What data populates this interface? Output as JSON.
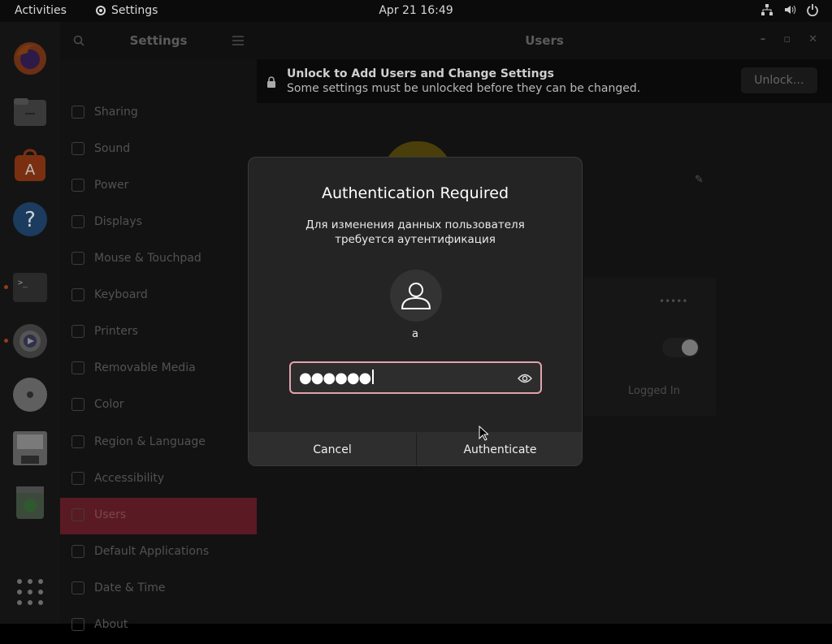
{
  "topbar": {
    "activities": "Activities",
    "app_name": "Settings",
    "clock": "Apr 21  16:49",
    "tray_icons": [
      "network-icon",
      "volume-icon",
      "power-icon"
    ]
  },
  "dock": {
    "items": [
      "firefox-icon",
      "files-icon",
      "app-center-icon",
      "help-icon",
      "terminal-icon",
      "settings-icon",
      "disc-icon",
      "save-disk-icon",
      "trash-icon"
    ],
    "show_apps_icon": "grid-icon"
  },
  "settings": {
    "sidebar_title": "Settings",
    "main_title": "Users",
    "sidebar": [
      {
        "label": "Sharing",
        "icon": "sharing-icon"
      },
      {
        "label": "Sound",
        "icon": "music-note-icon"
      },
      {
        "label": "Power",
        "icon": "power-icon"
      },
      {
        "label": "Displays",
        "icon": "display-icon"
      },
      {
        "label": "Mouse & Touchpad",
        "icon": "mouse-icon"
      },
      {
        "label": "Keyboard",
        "icon": "keyboard-icon"
      },
      {
        "label": "Printers",
        "icon": "printer-icon"
      },
      {
        "label": "Removable Media",
        "icon": "usb-icon"
      },
      {
        "label": "Color",
        "icon": "color-icon"
      },
      {
        "label": "Region & Language",
        "icon": "globe-icon"
      },
      {
        "label": "Accessibility",
        "icon": "accessibility-icon"
      },
      {
        "label": "Users",
        "icon": "users-icon",
        "active": true
      },
      {
        "label": "Default Applications",
        "icon": "star-icon"
      },
      {
        "label": "Date & Time",
        "icon": "clock-icon"
      },
      {
        "label": "About",
        "icon": "info-icon"
      }
    ],
    "unlock_bar": {
      "title": "Unlock to Add Users and Change Settings",
      "subtitle": "Some settings must be unlocked before they can be changed.",
      "button": "Unlock…"
    },
    "background": {
      "password_mask": "•••••",
      "logged_in": "Logged In"
    }
  },
  "dialog": {
    "title": "Authentication Required",
    "message_line1": "Для изменения данных пользователя",
    "message_line2": "требуется аутентификация",
    "username": "a",
    "password_masked": "●●●●●●",
    "cancel": "Cancel",
    "authenticate": "Authenticate",
    "colors": {
      "focus_border": "#e3a2ac",
      "dialog_bg": "#242424",
      "active_item": "#5a1a24"
    }
  }
}
